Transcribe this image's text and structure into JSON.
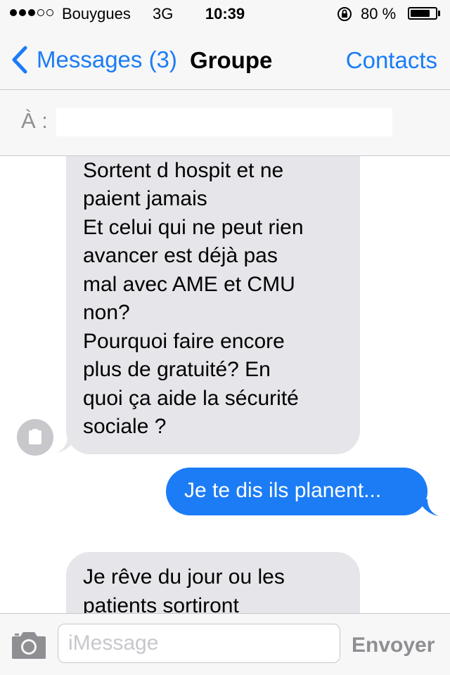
{
  "status_bar": {
    "signal_bars_filled": 3,
    "signal_bars_total": 5,
    "carrier": "Bouygues",
    "network": "3G",
    "time": "10:39",
    "battery_percent": "80 %",
    "battery_level": 0.8
  },
  "nav": {
    "back_label": "Messages (3)",
    "title": "Groupe",
    "contacts_label": "Contacts"
  },
  "to_field": {
    "label": "À :"
  },
  "messages": [
    {
      "direction": "incoming",
      "lines": [
        "Sortent d hospit et ne",
        "paient jamais",
        "Et celui qui ne peut rien",
        "avancer est déjà pas",
        "mal avec AME et CMU",
        "non?",
        "Pourquoi faire encore",
        "plus de gratuité? En",
        "quoi ça aide la sécurité",
        "sociale ?"
      ]
    },
    {
      "direction": "outgoing",
      "lines": [
        "Je te dis ils planent..."
      ]
    },
    {
      "direction": "incoming",
      "lines": [
        "Je rêve du jour ou les",
        "patients sortiront"
      ]
    }
  ],
  "composer": {
    "placeholder": "iMessage",
    "send_label": "Envoyer"
  },
  "colors": {
    "accent": "#1b7cf6",
    "incoming_bubble": "#e5e5ea",
    "bar_background": "#f7f7f7",
    "separator": "#c8c7cc",
    "muted": "#8e8e93"
  }
}
